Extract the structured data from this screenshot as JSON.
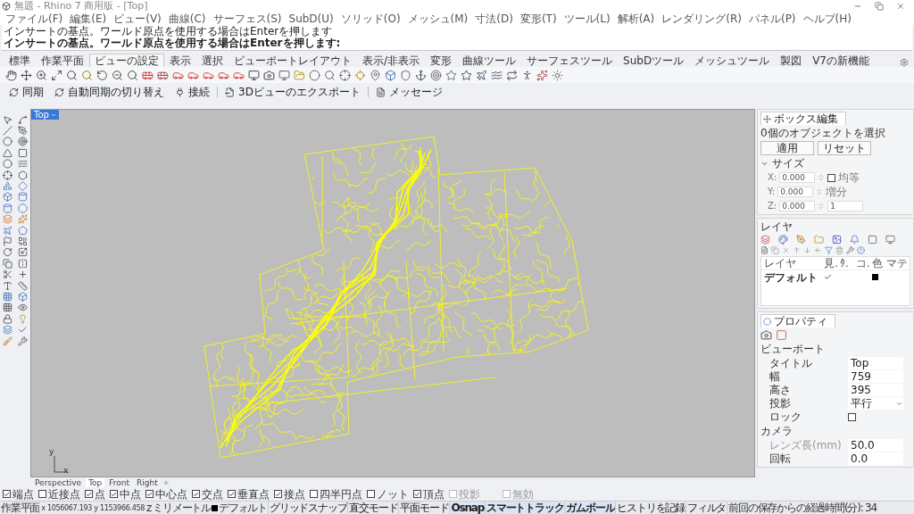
{
  "window": {
    "title": "無題 - Rhino 7 商用版 - [Top]"
  },
  "menu": [
    "ファイル(F)",
    "編集(E)",
    "ビュー(V)",
    "曲線(C)",
    "サーフェス(S)",
    "SubD(U)",
    "ソリッド(O)",
    "メッシュ(M)",
    "寸法(D)",
    "変形(T)",
    "ツール(L)",
    "解析(A)",
    "レンダリング(R)",
    "パネル(P)",
    "ヘルプ(H)"
  ],
  "command_history": [
    "インサートの基点。ワールド原点を使用する場合はEnterを押します"
  ],
  "command_prompt": "インサートの基点。ワールド原点を使用する場合はEnterを押します:",
  "toolbar_tabs": [
    {
      "label": "標準",
      "selected": false
    },
    {
      "label": "作業平面",
      "selected": false
    },
    {
      "label": "ビューの設定",
      "selected": true
    },
    {
      "label": "表示",
      "selected": false
    },
    {
      "label": "選択",
      "selected": false
    },
    {
      "label": "ビューポートレイアウト",
      "selected": false
    },
    {
      "label": "表示/非表示",
      "selected": false
    },
    {
      "label": "変形",
      "selected": false
    },
    {
      "label": "曲線ツール",
      "selected": false
    },
    {
      "label": "サーフェスツール",
      "selected": false
    },
    {
      "label": "SubDツール",
      "selected": false
    },
    {
      "label": "メッシュツール",
      "selected": false
    },
    {
      "label": "製図",
      "selected": false
    },
    {
      "label": "V7の新機能",
      "selected": false
    }
  ],
  "viewport_toolbar": [
    "同期",
    "自動同期の切り替え",
    "接続",
    "3Dビューのエクスポート",
    "メッセージ"
  ],
  "viewport": {
    "label": "Top",
    "axis_labels": [
      "y",
      "x"
    ]
  },
  "viewport_tabs": [
    {
      "label": "Perspective",
      "selected": false
    },
    {
      "label": "Top",
      "selected": true
    },
    {
      "label": "Front",
      "selected": false
    },
    {
      "label": "Right",
      "selected": false
    }
  ],
  "osnaps": [
    {
      "label": "端点",
      "checked": true,
      "disabled": false
    },
    {
      "label": "近接点",
      "checked": false,
      "disabled": false
    },
    {
      "label": "点",
      "checked": true,
      "disabled": false
    },
    {
      "label": "中点",
      "checked": true,
      "disabled": false
    },
    {
      "label": "中心点",
      "checked": true,
      "disabled": false
    },
    {
      "label": "交点",
      "checked": true,
      "disabled": false
    },
    {
      "label": "垂直点",
      "checked": true,
      "disabled": false
    },
    {
      "label": "接点",
      "checked": true,
      "disabled": false
    },
    {
      "label": "四半円点",
      "checked": false,
      "disabled": false
    },
    {
      "label": "ノット",
      "checked": false,
      "disabled": false
    },
    {
      "label": "頂点",
      "checked": true,
      "disabled": false
    },
    {
      "label": "投影",
      "checked": false,
      "disabled": true
    },
    {
      "label": "無効",
      "checked": false,
      "disabled": true
    }
  ],
  "status_bar": {
    "plane": "作業平面",
    "coordinates": "x 1056067.193 y 1153966.458",
    "z": "z",
    "units": "ミリメートル",
    "layer": "デフォルト",
    "toggles": [
      {
        "label": "グリッドスナップ",
        "on": false
      },
      {
        "label": "直交モード",
        "on": false
      },
      {
        "label": "平面モード",
        "on": false
      },
      {
        "label": "Osnap",
        "on": true
      },
      {
        "label": "スマートトラック",
        "on": true
      },
      {
        "label": "ガムボール",
        "on": true
      },
      {
        "label": "ヒストリを記録",
        "on": false
      },
      {
        "label": "フィルタ",
        "on": false
      }
    ],
    "message": "前回の保存からの経過時間(分): 34"
  },
  "box_edit": {
    "tab": "ボックス編集",
    "selection": "0個のオブジェクトを選択",
    "buttons": [
      "適用",
      "リセット"
    ],
    "section": "サイズ",
    "expanded": true,
    "fields": [
      {
        "axis": "X:",
        "value": "0.000"
      },
      {
        "axis": "Y:",
        "value": "0.000"
      },
      {
        "axis": "Z:",
        "value": "0.000"
      }
    ],
    "uniform": {
      "label": "均等",
      "checked": false
    },
    "increment_label": "増分",
    "increment": "1"
  },
  "layers": {
    "title": "レイヤ",
    "columns": [
      "レイヤ",
      "見.",
      "ﾀ.",
      "コ.",
      "色",
      "マテ"
    ],
    "rows": [
      {
        "name": "デフォルト",
        "current": true,
        "color": "#000000"
      }
    ]
  },
  "properties": {
    "tab": "プロパティ",
    "sections": [
      {
        "title": "ビューポート",
        "rows": [
          {
            "label": "タイトル",
            "kind": "text",
            "value": "Top",
            "disabled": false
          },
          {
            "label": "幅",
            "kind": "text",
            "value": "759",
            "disabled": false
          },
          {
            "label": "高さ",
            "kind": "text",
            "value": "395",
            "disabled": false
          },
          {
            "label": "投影",
            "kind": "select",
            "value": "平行",
            "disabled": false
          },
          {
            "label": "ロック",
            "kind": "checkbox",
            "checked": false,
            "disabled": false
          }
        ]
      },
      {
        "title": "カメラ",
        "rows": [
          {
            "label": "レンズ長(mm)",
            "kind": "text",
            "value": "50.0",
            "disabled": true
          },
          {
            "label": "回転",
            "kind": "text",
            "value": "0.0",
            "disabled": false
          }
        ]
      }
    ]
  }
}
